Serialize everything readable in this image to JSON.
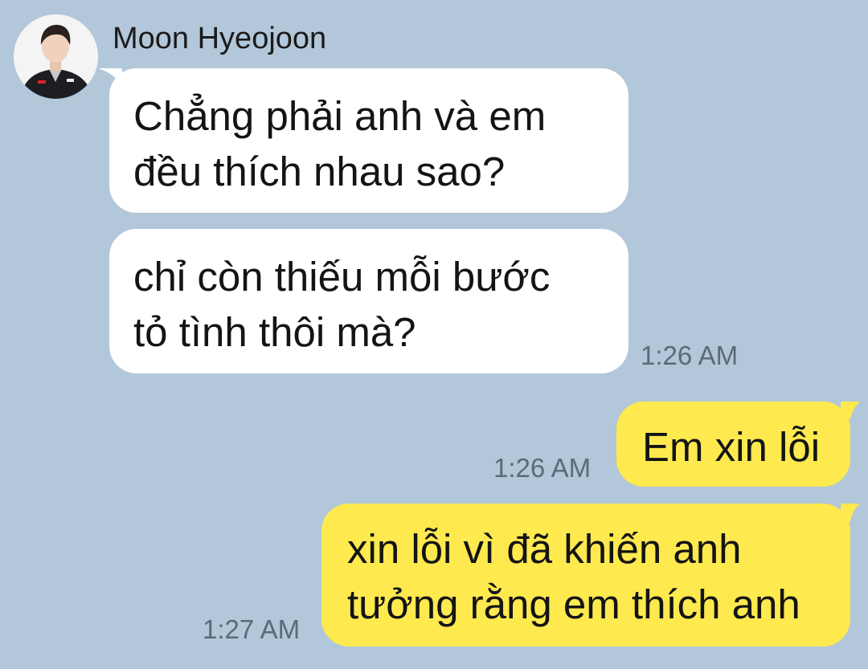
{
  "chat": {
    "sender": {
      "name": "Moon Hyeojoon"
    },
    "messages": [
      {
        "direction": "incoming",
        "lines": [
          "Chẳng phải anh và em",
          "đều thích nhau sao?"
        ]
      },
      {
        "direction": "incoming",
        "lines": [
          "chỉ còn thiếu mỗi bước",
          "tỏ tình thôi mà?"
        ],
        "time": "1:26 AM"
      },
      {
        "direction": "outgoing",
        "lines": [
          "Em xin lỗi"
        ],
        "time": "1:26 AM"
      },
      {
        "direction": "outgoing",
        "lines": [
          "xin lỗi vì đã khiến anh",
          "tưởng rằng em thích anh"
        ],
        "time": "1:27 AM"
      }
    ]
  },
  "colors": {
    "background": "#b2c7d9",
    "incoming_bubble": "#ffffff",
    "outgoing_bubble": "#fee94e",
    "timestamp": "#5d6a76"
  }
}
